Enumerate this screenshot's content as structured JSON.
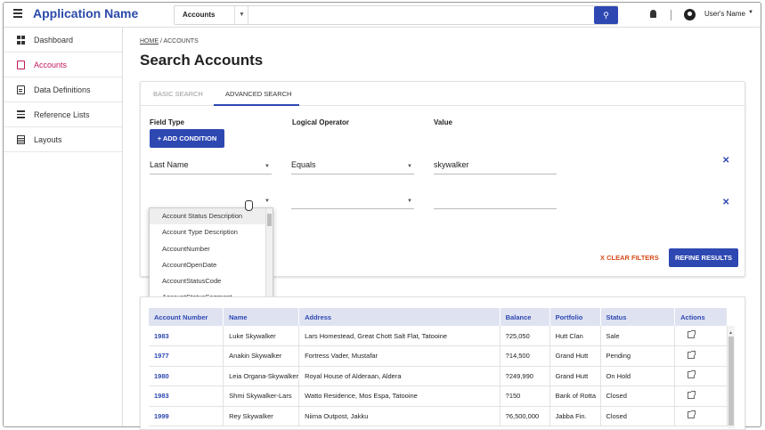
{
  "app": {
    "name": "Application Name",
    "search_scope": "Accounts",
    "search_placeholder": "",
    "user_name": "User's Name"
  },
  "sidebar": {
    "items": [
      {
        "label": "Dashboard",
        "icon": "dashboard-icon",
        "active": false
      },
      {
        "label": "Accounts",
        "icon": "file-icon",
        "active": true
      },
      {
        "label": "Data Definitions",
        "icon": "document-icon",
        "active": false
      },
      {
        "label": "Reference Lists",
        "icon": "list-icon",
        "active": false
      },
      {
        "label": "Layouts",
        "icon": "layout-icon",
        "active": false
      }
    ]
  },
  "breadcrumb": {
    "home": "HOME",
    "current": "ACCOUNTS"
  },
  "page_title": "Search Accounts",
  "tabs": {
    "basic": "BASIC SEARCH",
    "advanced": "ADVANCED SEARCH",
    "active": "advanced"
  },
  "filters": {
    "field_type_label": "Field Type",
    "operator_label": "Logical Operator",
    "value_label": "Value",
    "add_condition": "+ ADD CONDITION",
    "rows": [
      {
        "field": "Last Name",
        "operator": "Equals",
        "value": "skywalker"
      },
      {
        "field": "",
        "operator": "",
        "value": ""
      }
    ],
    "dropdown_options": [
      "Account Status Description",
      "Account Type Description",
      "AccountNumber",
      "AccountOpenDate",
      "AccountStatusCode",
      "AccountStatusSegment"
    ],
    "dropdown_highlighted": 0,
    "clear_filters": "CLEAR FILTERS",
    "refine_results": "REFINE RESULTS"
  },
  "results": {
    "columns": [
      "Account Number",
      "Name",
      "Address",
      "Balance",
      "Portfolio",
      "Status",
      "Actions"
    ],
    "rows": [
      {
        "account": "1983",
        "name": "Luke Skywalker",
        "address": "Lars Homestead, Great Chott Salt Flat, Tatooine",
        "balance": "?25,050",
        "portfolio": "Hutt Clan",
        "status": "Sale"
      },
      {
        "account": "1977",
        "name": "Anakin Skywalker",
        "address": "Fortress Vader, Mustafar",
        "balance": "?14,500",
        "portfolio": "Grand Hutt",
        "status": "Pending"
      },
      {
        "account": "1980",
        "name": "Leia Organa-Skywalker",
        "address": "Royal House of Alderaan, Aldera",
        "balance": "?249,990",
        "portfolio": "Grand Hutt",
        "status": "On Hold"
      },
      {
        "account": "1983",
        "name": "Shmi Skywalker-Lars",
        "address": "Watto Residence, Mos Espa, Tatooine",
        "balance": "?150",
        "portfolio": "Bank of Rotta",
        "status": "Closed"
      },
      {
        "account": "1999",
        "name": "Rey Skywalker",
        "address": "Niima Outpost, Jakku",
        "balance": "?6,500,000",
        "portfolio": "Jabba Fin.",
        "status": "Closed"
      }
    ]
  },
  "colors": {
    "accent": "#2e48b2",
    "active_nav": "#c2185b",
    "clear": "#d84a1b"
  }
}
